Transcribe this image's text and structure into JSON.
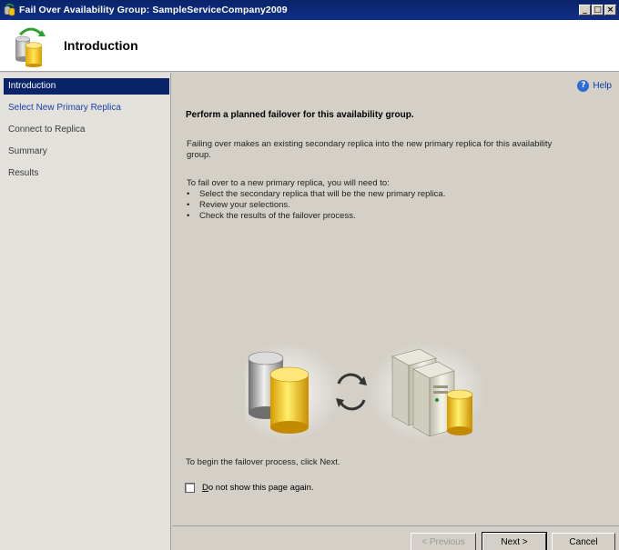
{
  "window": {
    "title": "Fail Over Availability Group: SampleServiceCompany2009",
    "controls": [
      "minimize",
      "maximize",
      "close"
    ]
  },
  "header": {
    "title": "Introduction"
  },
  "sidebar": {
    "items": [
      {
        "label": "Introduction",
        "state": "active"
      },
      {
        "label": "Select New Primary Replica",
        "state": "link"
      },
      {
        "label": "Connect to Replica",
        "state": "normal"
      },
      {
        "label": "Summary",
        "state": "normal"
      },
      {
        "label": "Results",
        "state": "normal"
      }
    ]
  },
  "main": {
    "help_label": "Help",
    "heading": "Perform a planned failover for this availability group.",
    "description_line1": "Failing over makes an existing secondary replica into the new primary replica for this availability",
    "description_line2": "group.",
    "steps_intro": "To fail over to a new primary replica, you will need to:",
    "steps": [
      "Select the secondary replica that will be the new primary replica.",
      "Review your selections.",
      "Check the results of the failover process."
    ],
    "begin_text": "To begin the failover process, click Next.",
    "dont_show_label": "Do not show this page again.",
    "dont_show_checked": false
  },
  "footer": {
    "previous_label": "< Previous",
    "next_label": "Next >",
    "cancel_label": "Cancel"
  },
  "colors": {
    "titlebar": "#0a246a",
    "nav_active": "#0a246a",
    "link": "#1a3fa8",
    "panel": "#d4d0c8"
  }
}
